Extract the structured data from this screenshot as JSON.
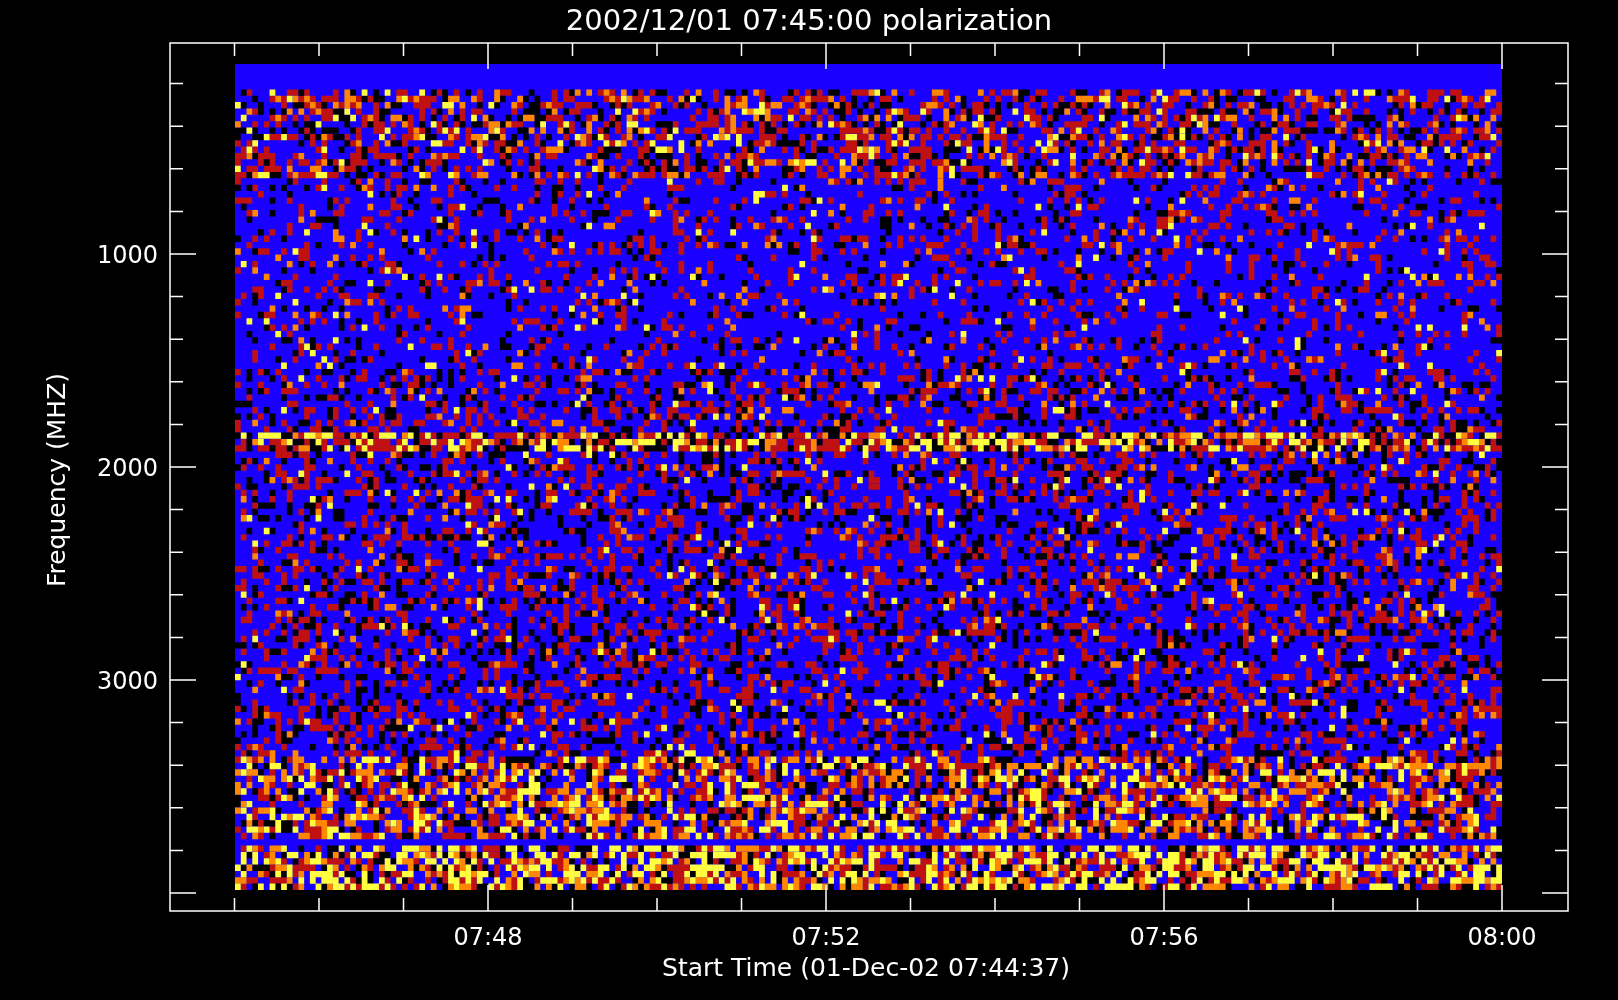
{
  "plot": {
    "title": "2002/12/01 07:45:00 polarization",
    "ylabel": "Frequency (MHZ)",
    "xlabel": "Start Time (01-Dec-02 07:44:37)",
    "yticks": [
      "1000",
      "2000",
      "3000"
    ],
    "xticks": [
      "07:48",
      "07:52",
      "07:56",
      "08:00"
    ]
  }
}
